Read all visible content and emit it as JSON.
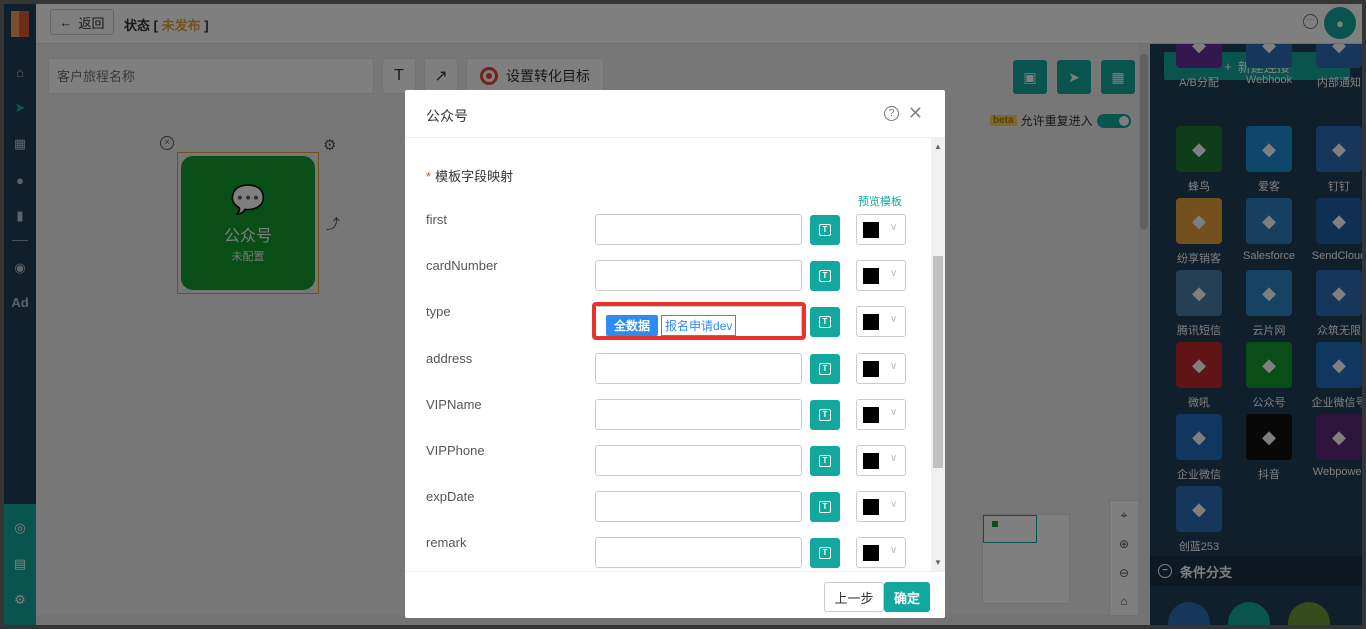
{
  "topbar": {
    "back_label": "返回",
    "status_prefix": "状态 [ ",
    "status_value": "未发布",
    "status_suffix": " ]"
  },
  "toolbar": {
    "journey_name_placeholder": "客户旅程名称",
    "text_tool": "T",
    "arrow_tool": "↗",
    "goal_label": "设置转化目标"
  },
  "canvas": {
    "beta_tag": "beta",
    "repeat_label": "允许重复进入",
    "node_title": "公众号",
    "node_subtitle": "未配置"
  },
  "leftnav": {
    "ad_label": "Ad"
  },
  "rightpanel": {
    "new_conn_label": "新建连接",
    "plugins": [
      {
        "label": "A/B分配",
        "color": "#6a2fa0",
        "icon": "ab-icon"
      },
      {
        "label": "Webhook",
        "color": "#2d6fb6",
        "icon": "webhook-icon"
      },
      {
        "label": "内部通知",
        "color": "#2d6fb6",
        "icon": "notify-icon"
      },
      {
        "label": "蜂鸟",
        "color": "#1f7a33",
        "icon": "spider-icon"
      },
      {
        "label": "爱客",
        "color": "#1f8fd8",
        "icon": "k-icon"
      },
      {
        "label": "钉钉",
        "color": "#2d6fb6",
        "icon": "dingtalk-icon"
      },
      {
        "label": "纷享销客",
        "color": "#e6a23c",
        "icon": "fxk-icon"
      },
      {
        "label": "Salesforce",
        "color": "#2d7fc1",
        "icon": "cloud-icon"
      },
      {
        "label": "SendCloud",
        "color": "#1f5fa6",
        "icon": "sendcloud-icon"
      },
      {
        "label": "腾讯短信",
        "color": "#4a7fa8",
        "icon": "tencent-icon"
      },
      {
        "label": "云片网",
        "color": "#2d87c8",
        "icon": "yunpian-icon"
      },
      {
        "label": "众筑无限",
        "color": "#2d6fb6",
        "icon": "zz-icon"
      },
      {
        "label": "微吼",
        "color": "#c0282a",
        "icon": "weihou-icon"
      },
      {
        "label": "公众号",
        "color": "#129a2e",
        "icon": "wechat-icon"
      },
      {
        "label": "企业微信号",
        "color": "#1f6fc0",
        "icon": "wework-icon"
      },
      {
        "label": "企业微信",
        "color": "#1f6fc0",
        "icon": "wework2-icon"
      },
      {
        "label": "抖音",
        "color": "#111111",
        "icon": "douyin-icon"
      },
      {
        "label": "Webpower",
        "color": "#5a2a7a",
        "icon": "webpower-icon"
      },
      {
        "label": "创蓝253",
        "color": "#2d6fb6",
        "icon": "chuanglan-icon"
      }
    ],
    "cond_label": "条件分支"
  },
  "dialog": {
    "title": "公众号",
    "section_label": "模板字段映射",
    "preview_link": "预览模板",
    "fields": [
      {
        "label": "first"
      },
      {
        "label": "cardNumber"
      },
      {
        "label": "type"
      },
      {
        "label": "address"
      },
      {
        "label": "VIPName"
      },
      {
        "label": "VIPPhone"
      },
      {
        "label": "expDate"
      },
      {
        "label": "remark"
      }
    ],
    "type_tag_source": "全数据",
    "type_tag_value": "报名申请dev",
    "prev_label": "上一步",
    "ok_label": "确定"
  }
}
